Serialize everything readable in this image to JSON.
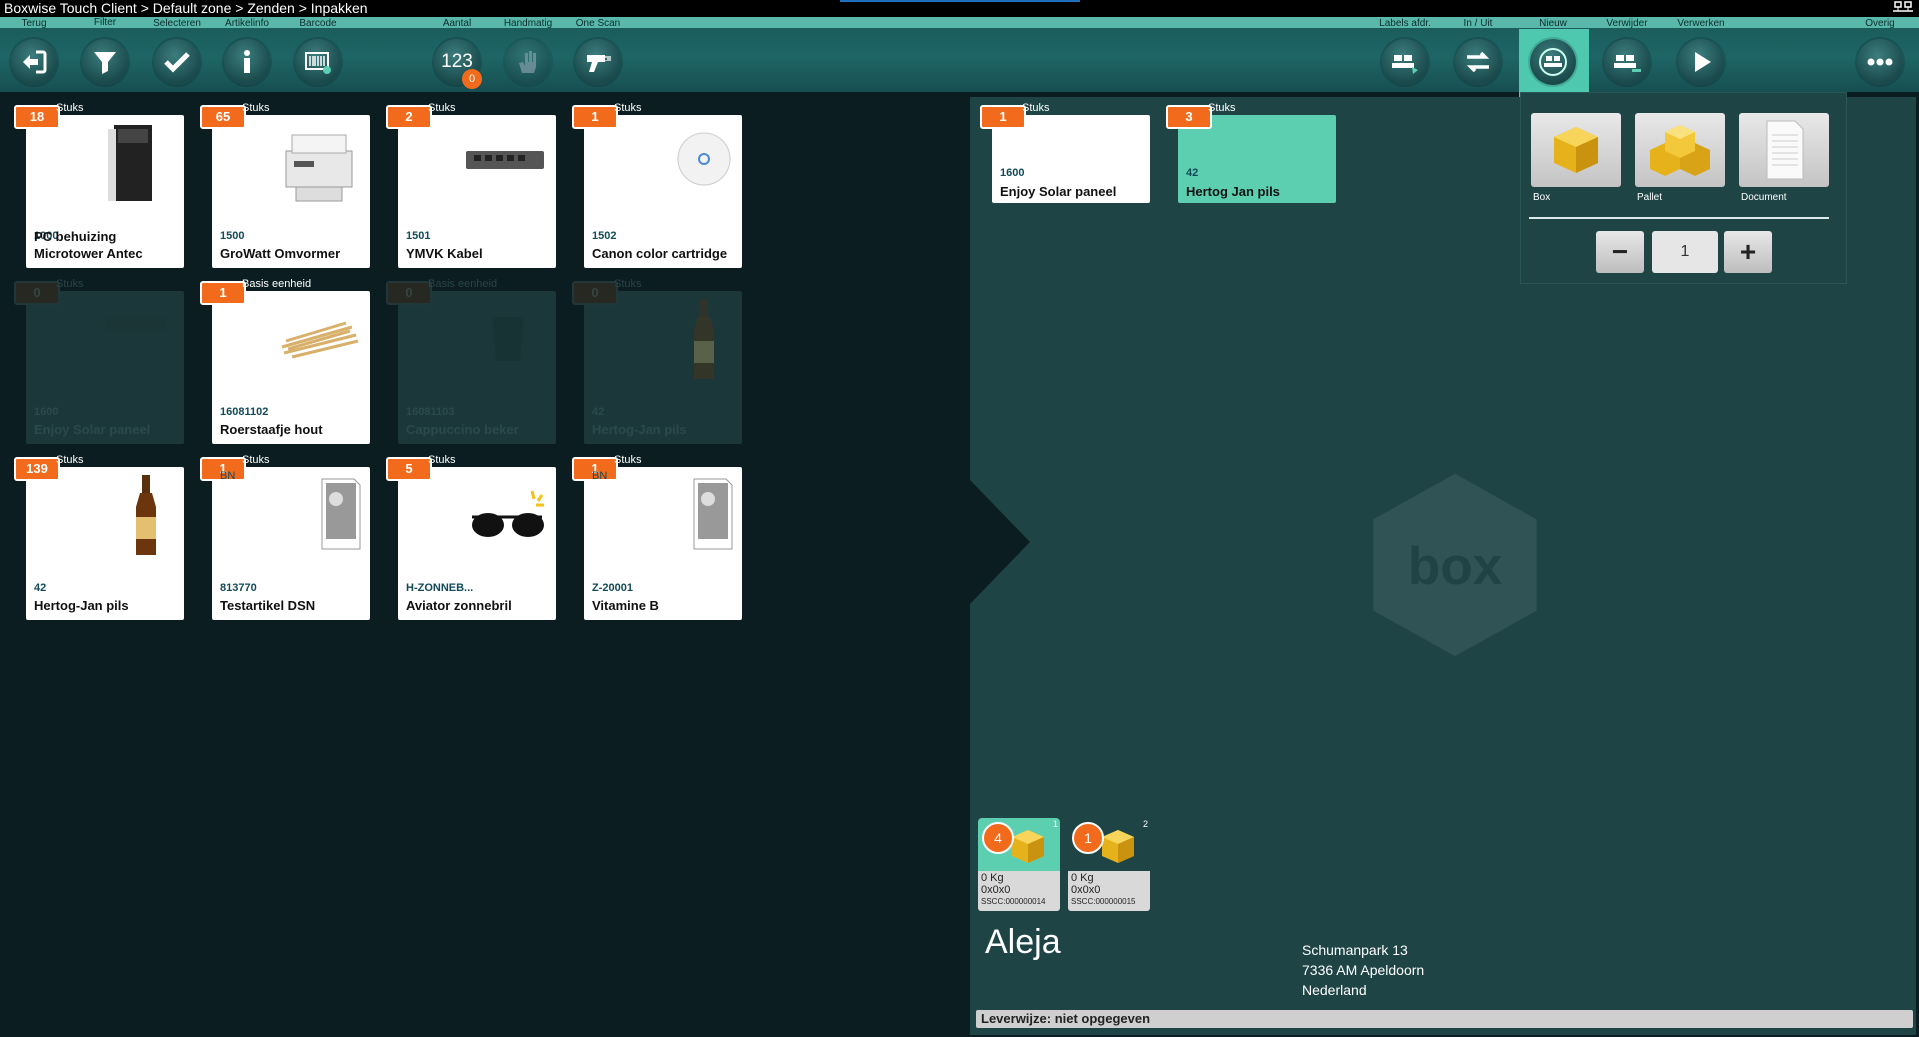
{
  "title_bar": {
    "text": "Boxwise Touch Client > Default zone > Zenden > Inpakken"
  },
  "toolbar": {
    "left_labels": [
      "Terug",
      "Filter",
      "Selecteren",
      "Artikelinfo",
      "Barcode",
      "Aantal",
      "Handmatig",
      "One Scan"
    ],
    "right_labels": [
      "Labels afdr.",
      "In / Uit",
      "Nieuw",
      "Verwijder",
      "Verwerken",
      "Overig"
    ],
    "aantal_value": "123",
    "aantal_badge": "0"
  },
  "articles": [
    {
      "qty": "18",
      "unit": "Stuks",
      "code": "1000",
      "name": "PC behuizing Microtower Antec",
      "top_code": "",
      "icon": "pc-case",
      "dim": false
    },
    {
      "qty": "65",
      "unit": "Stuks",
      "code": "1500",
      "name": "GroWatt Omvormer",
      "top_code": "",
      "icon": "printer",
      "dim": false
    },
    {
      "qty": "2",
      "unit": "Stuks",
      "code": "1501",
      "name": "YMVK Kabel",
      "top_code": "",
      "icon": "network-switch",
      "dim": false
    },
    {
      "qty": "1",
      "unit": "Stuks",
      "code": "1502",
      "name": "Canon color cartridge",
      "top_code": "",
      "icon": "access-point",
      "dim": false
    },
    {
      "qty": "0",
      "unit": "Stuks",
      "code": "1600",
      "name": "Enjoy Solar paneel",
      "top_code": "",
      "icon": "solar-panel",
      "dim": true
    },
    {
      "qty": "1",
      "unit": "Basis eenheid",
      "code": "16081102",
      "name": "Roerstaafje hout",
      "top_code": "",
      "icon": "stirrers",
      "dim": false
    },
    {
      "qty": "0",
      "unit": "Basis eenheid",
      "code": "16081103",
      "name": "Cappuccino beker",
      "top_code": "",
      "icon": "cup",
      "dim": true
    },
    {
      "qty": "0",
      "unit": "Stuks",
      "code": "42",
      "name": "Hertog-Jan pils",
      "top_code": "",
      "icon": "beer-bottle",
      "dim": true
    },
    {
      "qty": "139",
      "unit": "Stuks",
      "code": "42",
      "name": "Hertog-Jan pils",
      "top_code": "",
      "icon": "beer-bottle",
      "dim": false
    },
    {
      "qty": "1",
      "unit": "Stuks",
      "code": "813770",
      "name": "Testartikel DSN",
      "top_code": "BN",
      "icon": "no-image",
      "dim": false
    },
    {
      "qty": "5",
      "unit": "Stuks",
      "code": "H-ZONNEB...",
      "name": "Aviator zonnebril",
      "top_code": "",
      "icon": "sunglasses",
      "dim": false
    },
    {
      "qty": "1",
      "unit": "Stuks",
      "code": "Z-20001",
      "name": "Vitamine B",
      "top_code": "BN",
      "icon": "no-image",
      "dim": false
    }
  ],
  "package_contents": [
    {
      "qty": "1",
      "unit": "Stuks",
      "code": "1600",
      "name": "Enjoy Solar paneel",
      "selected": false
    },
    {
      "qty": "3",
      "unit": "Stuks",
      "code": "42",
      "name": "Hertog Jan pils",
      "selected": true
    }
  ],
  "new_panel": {
    "options": [
      "Box",
      "Pallet",
      "Document"
    ],
    "stepper_value": "1",
    "minus": "−",
    "plus": "+"
  },
  "packages": [
    {
      "count": "4",
      "index": "1",
      "weight": "0 Kg",
      "dims": "0x0x0",
      "sscc": "SSCC:000000014",
      "selected": true
    },
    {
      "count": "1",
      "index": "2",
      "weight": "0 Kg",
      "dims": "0x0x0",
      "sscc": "SSCC:000000015",
      "selected": false
    }
  ],
  "customer": {
    "name": "Aleja",
    "address_line1": "Schumanpark 13",
    "address_line2": "7336 AM Apeldoorn",
    "address_line3": "Nederland"
  },
  "delivery": {
    "text": "Leverwijze: niet opgegeven"
  },
  "colors": {
    "accent": "#5dcfb1",
    "orange": "#f26a1b",
    "background": "#0b1d20",
    "panel": "#1e4446"
  }
}
